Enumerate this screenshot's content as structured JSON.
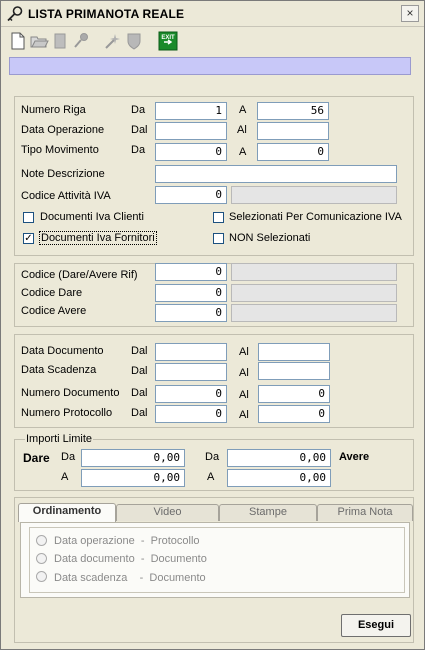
{
  "window": {
    "title": "LISTA PRIMANOTA REALE",
    "close_label": "×"
  },
  "toolbar": {
    "items": [
      {
        "name": "new-document-icon",
        "enabled": true
      },
      {
        "name": "open-folder-icon",
        "enabled": true
      },
      {
        "name": "document-icon",
        "enabled": false
      },
      {
        "name": "key-icon",
        "enabled": false
      },
      {
        "name": "wizard-icon",
        "enabled": false
      },
      {
        "name": "shield-icon",
        "enabled": false
      },
      {
        "name": "exit-icon",
        "enabled": true
      }
    ],
    "exit_label": "EXIT"
  },
  "range": {
    "rows": [
      {
        "label": "Numero Riga",
        "from_label": "Da",
        "from": "1",
        "to_label": "A",
        "to": "56"
      },
      {
        "label": "Data Operazione",
        "from_label": "Dal",
        "from": "",
        "to_label": "Al",
        "to": ""
      },
      {
        "label": "Tipo Movimento",
        "from_label": "Da",
        "from": "0",
        "to_label": "A",
        "to": "0"
      }
    ],
    "note_label": "Note Descrizione",
    "note_value": "",
    "iva_code_label": "Codice Attività IVA",
    "iva_code_value": "0",
    "checkboxes": [
      {
        "label": "Documenti Iva Clienti",
        "checked": false
      },
      {
        "label": "Selezionati Per Comunicazione IVA",
        "checked": false
      },
      {
        "label": "Documenti Iva Fornitori",
        "checked": true
      },
      {
        "label": "NON Selezionati",
        "checked": false
      }
    ]
  },
  "codes": {
    "rows": [
      {
        "label": "Codice (Dare/Avere Rif)",
        "value": "0"
      },
      {
        "label": "Codice Dare",
        "value": "0"
      },
      {
        "label": "Codice Avere",
        "value": "0"
      }
    ]
  },
  "documents": {
    "rows": [
      {
        "label": "Data Documento",
        "from_label": "Dal",
        "from": "",
        "to_label": "Al",
        "to": ""
      },
      {
        "label": "Data Scadenza",
        "from_label": "Dal",
        "from": "",
        "to_label": "Al",
        "to": ""
      },
      {
        "label": "Numero Documento",
        "from_label": "Dal",
        "from": "0",
        "to_label": "Al",
        "to": "0"
      },
      {
        "label": "Numero Protocollo",
        "from_label": "Dal",
        "from": "0",
        "to_label": "Al",
        "to": "0"
      }
    ]
  },
  "importi": {
    "legend": "Importi Limite",
    "dare_label": "Dare",
    "avere_label": "Avere",
    "da_label": "Da",
    "a_label": "A",
    "dare_from": "0,00",
    "dare_to": "0,00",
    "avere_from": "0,00",
    "avere_to": "0,00"
  },
  "tabs": {
    "items": [
      {
        "label": "Ordinamento",
        "active": true
      },
      {
        "label": "Video",
        "active": false
      },
      {
        "label": "Stampe",
        "active": false
      },
      {
        "label": "Prima Nota",
        "active": false
      }
    ],
    "sort_options": [
      "Data operazione  -  Protocollo",
      "Data documento  -  Documento",
      "Data scadenza    -  Documento"
    ]
  },
  "actions": {
    "execute_label": "Esegui"
  }
}
